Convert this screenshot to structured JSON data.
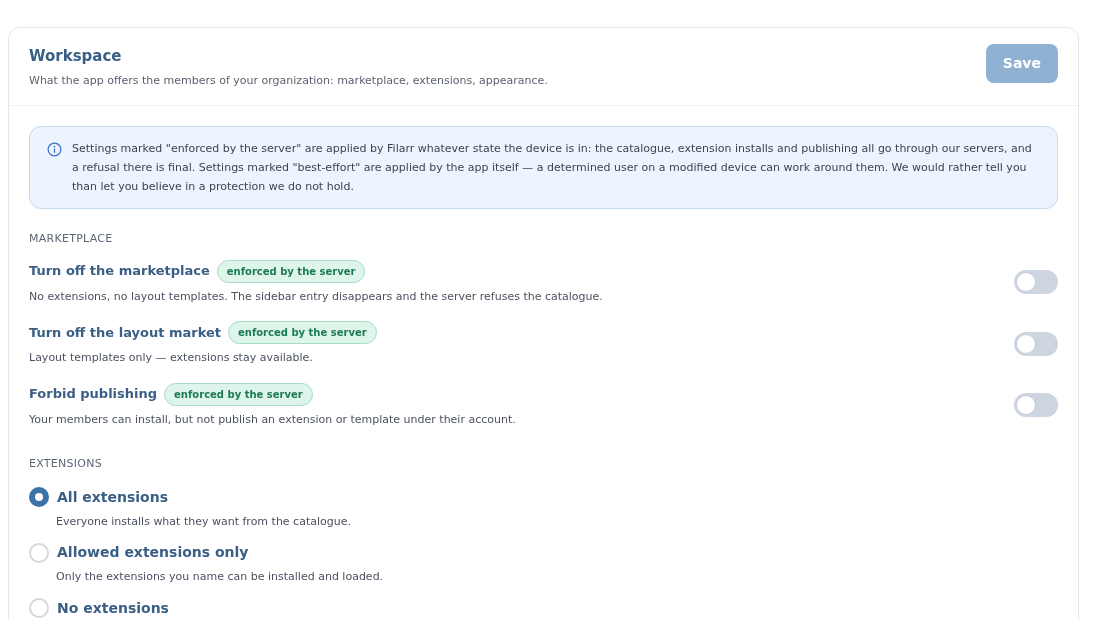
{
  "header": {
    "title": "Workspace",
    "subtitle": "What the app offers the members of your organization: marketplace, extensions, appearance.",
    "save_button": {
      "label": "Save",
      "disabled": true
    }
  },
  "notice": "Settings marked \"enforced by the server\" are applied by Filarr whatever state the device is in: the catalogue, extension installs and publishing all go through our servers, and a refusal there is final. Settings marked \"best-effort\" are applied by the app itself — a determined user on a modified device can work around them. We would rather tell you than let you believe in a protection we do not hold.",
  "marketplace": {
    "heading": "MARKETPLACE",
    "toggles": [
      {
        "label": "Turn off the marketplace",
        "badge": "enforced by the server",
        "description": "No extensions, no layout templates. The sidebar entry disappears and the server refuses the catalogue.",
        "on": false
      },
      {
        "label": "Turn off the layout market",
        "badge": "enforced by the server",
        "description": "Layout templates only — extensions stay available.",
        "on": false
      },
      {
        "label": "Forbid publishing",
        "badge": "enforced by the server",
        "description": "Your members can install, but not publish an extension or template under their account.",
        "on": false
      }
    ]
  },
  "extensions": {
    "heading": "EXTENSIONS",
    "options": [
      {
        "label": "All extensions",
        "description": "Everyone installs what they want from the catalogue.",
        "selected": true
      },
      {
        "label": "Allowed extensions only",
        "description": "Only the extensions you name can be installed and loaded.",
        "selected": false
      },
      {
        "label": "No extensions",
        "selected": false
      }
    ]
  }
}
